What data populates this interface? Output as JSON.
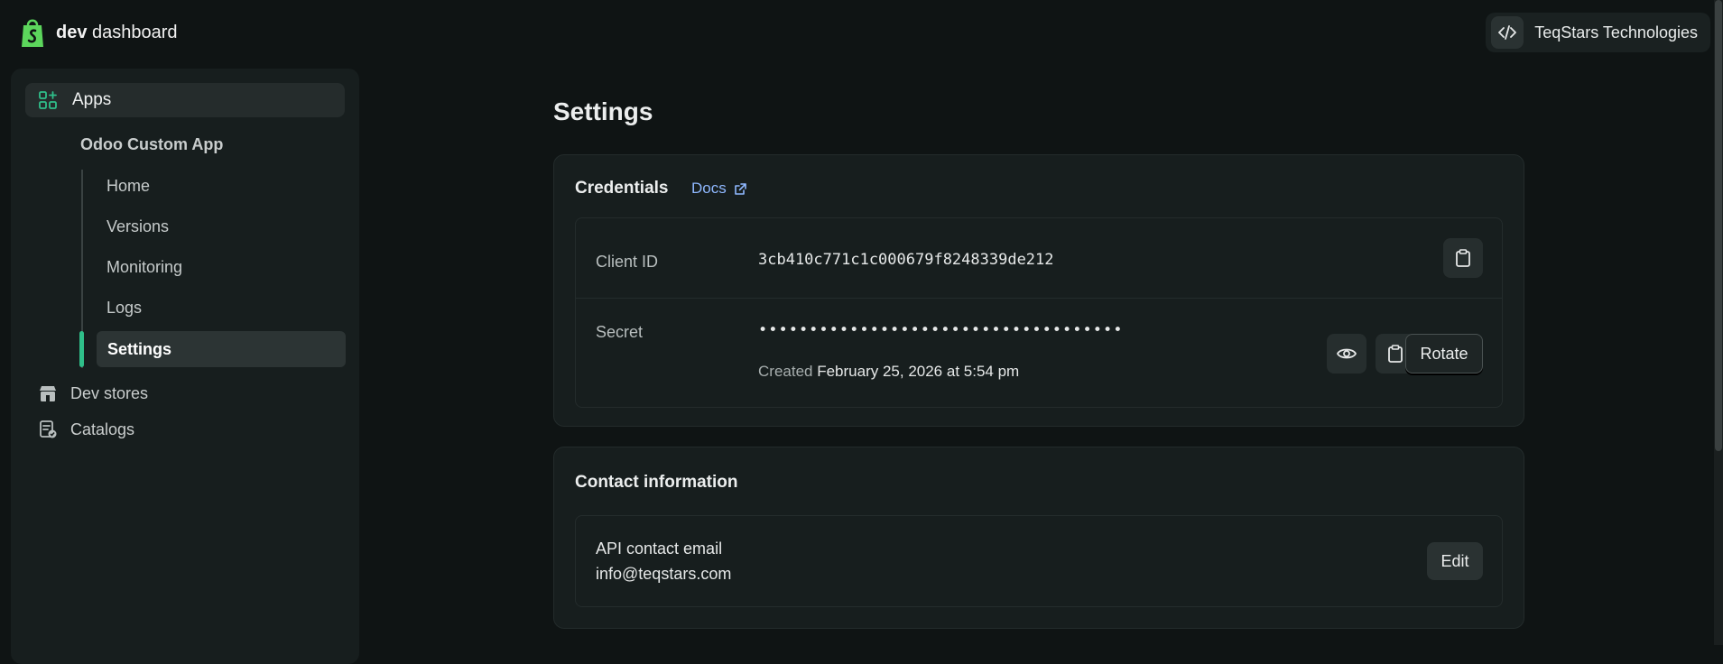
{
  "brand": {
    "bold": "dev",
    "rest": "dashboard"
  },
  "org": {
    "name": "TeqStars Technologies"
  },
  "sidebar": {
    "apps_label": "Apps",
    "app_name": "Odoo Custom App",
    "subnav": [
      "Home",
      "Versions",
      "Monitoring",
      "Logs",
      "Settings"
    ],
    "secondary": [
      "Dev stores",
      "Catalogs"
    ]
  },
  "main": {
    "title": "Settings",
    "credentials": {
      "title": "Credentials",
      "docs_label": "Docs",
      "client_id_label": "Client ID",
      "client_id_value": "3cb410c771c1c000679f8248339de212",
      "secret_label": "Secret",
      "secret_value": "••••••••••••••••••••••••••••••••••••",
      "created_prefix": "Created",
      "created_date": "February 25, 2026 at 5:54 pm",
      "rotate_label": "Rotate"
    },
    "contact": {
      "title": "Contact information",
      "email_label": "API contact email",
      "email_value": "info@teqstars.com",
      "edit_label": "Edit"
    }
  },
  "colors": {
    "accent": "#2fbf8a",
    "link": "#8fb8ff",
    "background": "#0f1414",
    "card": "#171e1e"
  },
  "icons": [
    "shopify-bag-icon",
    "code-icon",
    "apps-grid-icon",
    "store-icon",
    "catalog-icon",
    "external-link-icon",
    "clipboard-icon",
    "eye-icon"
  ]
}
